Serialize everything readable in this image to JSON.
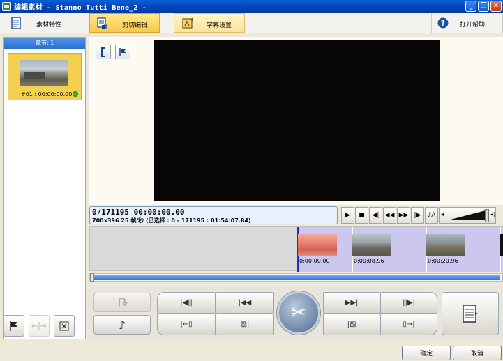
{
  "window": {
    "title": "编辑素材 - Stanno Tutti Bene_2 -"
  },
  "tabs": [
    {
      "label": "素材特性",
      "icon": "document-icon"
    },
    {
      "label": "剪切编辑",
      "icon": "film-edit-icon"
    },
    {
      "label": "字幕设置",
      "icon": "subtitle-edit-icon"
    }
  ],
  "help": {
    "label": "打开帮助...",
    "icon": "help-icon"
  },
  "chapters": {
    "header": "章节: 1",
    "items": [
      {
        "label": "#01 : 00:00:00.00"
      }
    ]
  },
  "timecode": {
    "main": "0/171195  00:00:00.00",
    "sub": "700x396 25 帧/秒 (已选择 : 0 - 171195 : 01:54:07.84)"
  },
  "timeline": {
    "clips": [
      {
        "time": "0:00:00.00"
      },
      {
        "time": "0:00:08.96"
      },
      {
        "time": "0:00:20.96"
      }
    ]
  },
  "buttons": {
    "ok": "确定",
    "cancel": "取消"
  },
  "colors": {
    "accent": "#f5cf4e",
    "title_bar": "#0a5fd6",
    "selection": "#ccc7ef",
    "cursor": "#1b2bd6"
  }
}
